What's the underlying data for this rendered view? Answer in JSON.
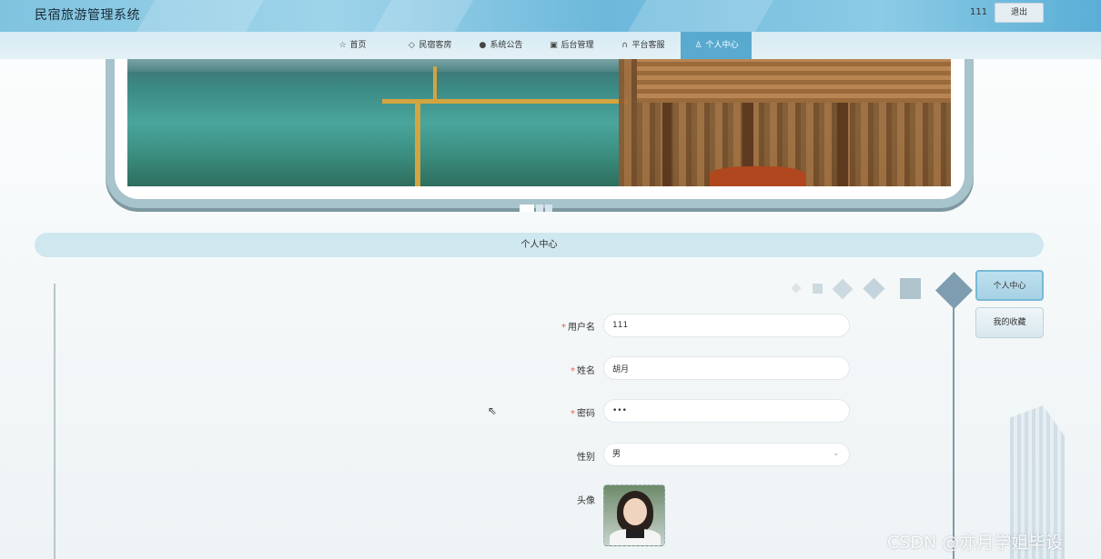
{
  "header": {
    "title": "民宿旅游管理系统",
    "user": "111",
    "logout_label": "退出"
  },
  "nav": [
    {
      "label": "首页",
      "icon": "star-icon",
      "glyph": "☆"
    },
    {
      "label": "民宿客房",
      "icon": "bag-icon",
      "glyph": "◇"
    },
    {
      "label": "系统公告",
      "icon": "info-icon",
      "glyph": "●"
    },
    {
      "label": "后台管理",
      "icon": "box-icon",
      "glyph": "▣"
    },
    {
      "label": "平台客服",
      "icon": "headset-icon",
      "glyph": "∩"
    },
    {
      "label": "个人中心",
      "icon": "user-icon",
      "glyph": "♙",
      "active": true
    }
  ],
  "section": {
    "title": "个人中心"
  },
  "side_menu": [
    {
      "label": "个人中心",
      "active": true
    },
    {
      "label": "我的收藏",
      "active": false
    }
  ],
  "form": {
    "username": {
      "label": "用户名",
      "required": true,
      "value": "111"
    },
    "name": {
      "label": "姓名",
      "required": true,
      "value": "胡月"
    },
    "password": {
      "label": "密码",
      "required": true,
      "value": "•••"
    },
    "gender": {
      "label": "性别",
      "required": false,
      "value": "男"
    },
    "avatar": {
      "label": "头像"
    }
  },
  "watermark": "CSDN @亦月学姐毕设",
  "colors": {
    "accent": "#5aaad0",
    "required": "#e8604c"
  }
}
